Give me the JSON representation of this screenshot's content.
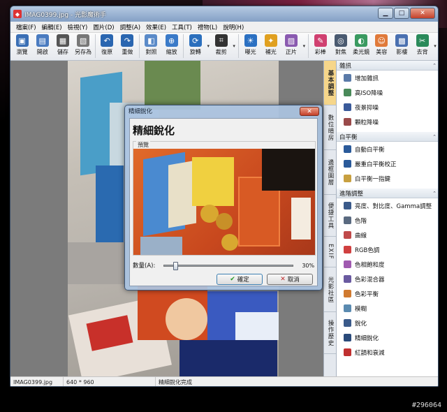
{
  "window": {
    "title": "IMAG0399.jpg - 光影魔術手"
  },
  "menu": [
    "檔案(F)",
    "編輯(E)",
    "檢視(Y)",
    "圖片(D)",
    "調整(A)",
    "效果(E)",
    "工具(T)",
    "禮物(L)",
    "說明(H)"
  ],
  "toolbar": {
    "items": [
      {
        "label": "瀏覽",
        "icon": "browse-icon",
        "color": "#3a6fb5"
      },
      {
        "label": "開啟",
        "icon": "open-icon",
        "color": "#4a7bc0"
      },
      {
        "label": "儲存",
        "icon": "save-icon",
        "color": "#555"
      },
      {
        "label": "另存為",
        "icon": "save-as-icon",
        "color": "#777"
      },
      {
        "label": "復原",
        "icon": "undo-icon",
        "color": "#2a66b0"
      },
      {
        "label": "重做",
        "icon": "redo-icon",
        "color": "#2a66b0"
      },
      {
        "label": "對照",
        "icon": "compare-icon",
        "color": "#5a8ac8"
      },
      {
        "label": "縮放",
        "icon": "zoom-icon",
        "color": "#3a7ac8"
      },
      {
        "label": "旋轉",
        "icon": "rotate-icon",
        "color": "#2b6fbd"
      },
      {
        "label": "裁剪",
        "icon": "crop-icon",
        "color": "#333"
      },
      {
        "label": "曝光",
        "icon": "exposure-icon",
        "color": "#2b70c2"
      },
      {
        "label": "補光",
        "icon": "fill-light-icon",
        "color": "#e0a020"
      },
      {
        "label": "正片",
        "icon": "slide-film-icon",
        "color": "#8a5ab0"
      },
      {
        "label": "彩棒",
        "icon": "color-wand-icon",
        "color": "#d04070"
      },
      {
        "label": "對焦",
        "icon": "focus-icon",
        "color": "#4a5a70"
      },
      {
        "label": "柔光鏡",
        "icon": "soft-lens-icon",
        "color": "#3a9a60"
      },
      {
        "label": "美容",
        "icon": "beauty-icon",
        "color": "#e07a3a"
      },
      {
        "label": "影樓",
        "icon": "studio-icon",
        "color": "#4a70b0"
      },
      {
        "label": "去背",
        "icon": "remove-bg-icon",
        "color": "#2a8a5a"
      }
    ]
  },
  "vtabs": [
    "基本調整",
    "數位暗房",
    "邊框圖層",
    "便捷工具",
    "EXIF",
    "光影社區",
    "操作歷史"
  ],
  "panel": {
    "sections": [
      {
        "title": "雜訊",
        "items": [
          {
            "label": "增加雜訊",
            "color": "#5a7aa8"
          },
          {
            "label": "高ISO降噪",
            "color": "#4a8a5a"
          },
          {
            "label": "夜景抑噪",
            "color": "#3a5a9a"
          },
          {
            "label": "顆粒降噪",
            "color": "#9a4a4a"
          }
        ]
      },
      {
        "title": "白平衡",
        "items": [
          {
            "label": "自動白平衡",
            "color": "#2a5a9a"
          },
          {
            "label": "嚴重白平衡校正",
            "color": "#2a5a9a"
          },
          {
            "label": "白平衡一指鍵",
            "color": "#c8a040"
          }
        ]
      },
      {
        "title": "進階調整",
        "items": [
          {
            "label": "亮度、對比度、Gamma調整",
            "color": "#3a5a8a"
          },
          {
            "label": "色階",
            "color": "#5a6a80"
          },
          {
            "label": "曲線",
            "color": "#c04a4a"
          },
          {
            "label": "RGB色調",
            "color": "#d04040"
          },
          {
            "label": "色相飽和度",
            "color": "#a05ab0"
          },
          {
            "label": "色彩混合器",
            "color": "#6a5aa0"
          },
          {
            "label": "色彩平衡",
            "color": "#d07a30"
          },
          {
            "label": "模糊",
            "color": "#5a8ab0"
          },
          {
            "label": "銳化",
            "color": "#3a5a8a"
          },
          {
            "label": "精細銳化",
            "color": "#2a4a7a"
          },
          {
            "label": "紅韻和衰減",
            "color": "#c03030"
          }
        ]
      }
    ]
  },
  "status": {
    "filename": "IMAG0399.jpg",
    "dimensions": "640 * 960",
    "message": "精細銳化完成"
  },
  "dialog": {
    "title": "精細銳化",
    "heading": "精細銳化",
    "preview_label": "預覽",
    "slider_label": "數量(A):",
    "slider_value": "30%",
    "slider_fraction": 0.07,
    "ok_label": "確定",
    "cancel_label": "取消"
  },
  "watermark": "#296064"
}
